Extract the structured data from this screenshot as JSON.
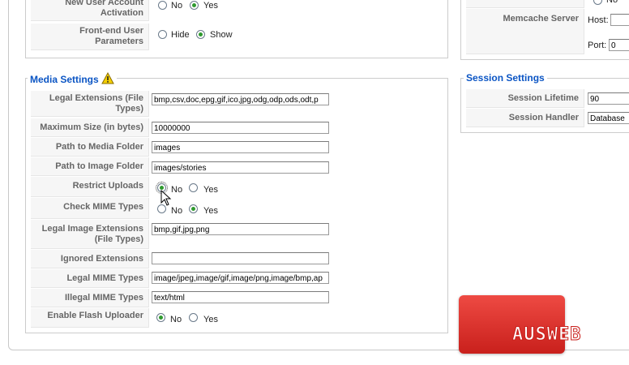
{
  "user_settings": {
    "new_user_activation": {
      "label": "New User Account Activation",
      "options": [
        "No",
        "Yes"
      ],
      "selected": "Yes"
    },
    "frontend_user_params": {
      "label": "Front-end User Parameters",
      "options": [
        "Hide",
        "Show"
      ],
      "selected": "Show"
    }
  },
  "memcache": {
    "label": "Memcache Server",
    "host_label": "Host:",
    "host_value": "",
    "port_label": "Port:",
    "port_value": "0",
    "top_option": "No"
  },
  "media": {
    "legend": "Media Settings",
    "warning_icon": "warning-icon",
    "legal_extensions": {
      "label": "Legal Extensions (File Types)",
      "value": "bmp,csv,doc,epg,gif,ico,jpg,odg,odp,ods,odt,p"
    },
    "max_size": {
      "label": "Maximum Size (in bytes)",
      "value": "10000000"
    },
    "media_path": {
      "label": "Path to Media Folder",
      "value": "images"
    },
    "image_path": {
      "label": "Path to Image Folder",
      "value": "images/stories"
    },
    "restrict_uploads": {
      "label": "Restrict Uploads",
      "options": [
        "No",
        "Yes"
      ],
      "selected": "No"
    },
    "check_mime": {
      "label": "Check MIME Types",
      "options": [
        "No",
        "Yes"
      ],
      "selected": "Yes"
    },
    "legal_image_ext": {
      "label": "Legal Image Extensions (File Types)",
      "value": "bmp,gif,jpg,png"
    },
    "ignored_ext": {
      "label": "Ignored Extensions",
      "value": ""
    },
    "legal_mime": {
      "label": "Legal MIME Types",
      "value": "image/jpeg,image/gif,image/png,image/bmp,ap"
    },
    "illegal_mime": {
      "label": "Illegal MIME Types",
      "value": "text/html"
    },
    "flash_uploader": {
      "label": "Enable Flash Uploader",
      "options": [
        "No",
        "Yes"
      ],
      "selected": "No"
    }
  },
  "session": {
    "legend": "Session Settings",
    "lifetime": {
      "label": "Session Lifetime",
      "value": "90"
    },
    "handler": {
      "label": "Session Handler",
      "value": "Database"
    }
  },
  "logo": {
    "text": "AUSWEB"
  }
}
